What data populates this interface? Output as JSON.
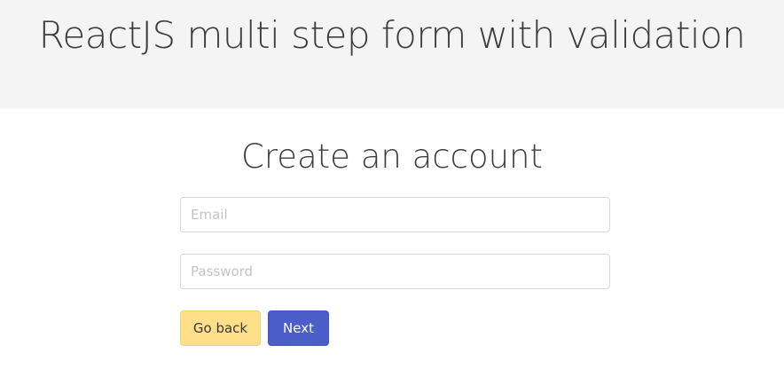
{
  "header": {
    "title": "ReactJS multi step form with validation"
  },
  "form": {
    "title": "Create an account",
    "email": {
      "placeholder": "Email",
      "value": ""
    },
    "password": {
      "placeholder": "Password",
      "value": ""
    },
    "back_label": "Go back",
    "next_label": "Next"
  },
  "colors": {
    "header_bg": "#f4f4f4",
    "back_button": "#ffdf8a",
    "next_button": "#4b5dc9"
  }
}
